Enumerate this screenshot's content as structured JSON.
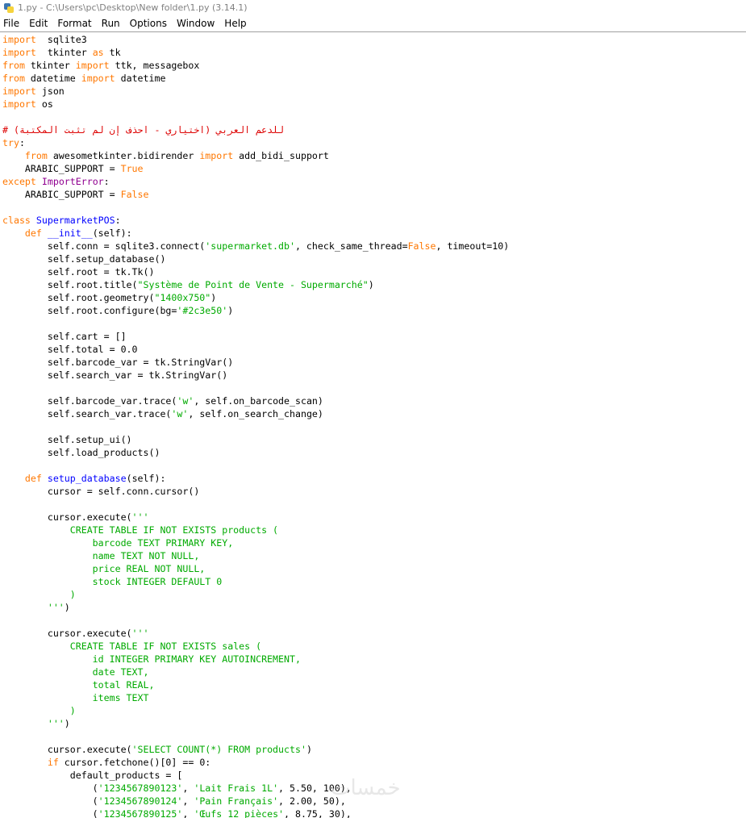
{
  "window": {
    "title": "1.py - C:\\Users\\pc\\Desktop\\New folder\\1.py (3.14.1)"
  },
  "menu": [
    "File",
    "Edit",
    "Format",
    "Run",
    "Options",
    "Window",
    "Help"
  ],
  "watermark": "خمسات",
  "code_lines": [
    [
      [
        "kw",
        "import"
      ],
      [
        "",
        "  sqlite3"
      ]
    ],
    [
      [
        "kw",
        "import"
      ],
      [
        "",
        "  tkinter "
      ],
      [
        "kw",
        "as"
      ],
      [
        "",
        " tk"
      ]
    ],
    [
      [
        "kw",
        "from"
      ],
      [
        "",
        " tkinter "
      ],
      [
        "kw",
        "import"
      ],
      [
        "",
        " ttk, messagebox"
      ]
    ],
    [
      [
        "kw",
        "from"
      ],
      [
        "",
        " datetime "
      ],
      [
        "kw",
        "import"
      ],
      [
        "",
        " datetime"
      ]
    ],
    [
      [
        "kw",
        "import"
      ],
      [
        "",
        " json"
      ]
    ],
    [
      [
        "kw",
        "import"
      ],
      [
        "",
        " os"
      ]
    ],
    [
      [
        "",
        ""
      ]
    ],
    [
      [
        "cm",
        "# للدعم العربي (اختياري - احذف إن لم تثبت المكتبة)"
      ]
    ],
    [
      [
        "kw",
        "try"
      ],
      [
        "",
        ":"
      ]
    ],
    [
      [
        "",
        "    "
      ],
      [
        "kw",
        "from"
      ],
      [
        "",
        " awesometkinter.bidirender "
      ],
      [
        "kw",
        "import"
      ],
      [
        "",
        " add_bidi_support"
      ]
    ],
    [
      [
        "",
        "    ARABIC_SUPPORT = "
      ],
      [
        "kw",
        "True"
      ]
    ],
    [
      [
        "kw",
        "except"
      ],
      [
        "",
        " "
      ],
      [
        "bi",
        "ImportError"
      ],
      [
        "",
        ":"
      ]
    ],
    [
      [
        "",
        "    ARABIC_SUPPORT = "
      ],
      [
        "kw",
        "False"
      ]
    ],
    [
      [
        "",
        ""
      ]
    ],
    [
      [
        "kw",
        "class"
      ],
      [
        "",
        " "
      ],
      [
        "df",
        "SupermarketPOS"
      ],
      [
        "",
        ":"
      ]
    ],
    [
      [
        "",
        "    "
      ],
      [
        "kw",
        "def"
      ],
      [
        "",
        " "
      ],
      [
        "df",
        "__init__"
      ],
      [
        "",
        "(self):"
      ]
    ],
    [
      [
        "",
        "        self.conn = sqlite3.connect("
      ],
      [
        "st",
        "'supermarket.db'"
      ],
      [
        "",
        ", check_same_thread="
      ],
      [
        "kw",
        "False"
      ],
      [
        "",
        ", timeout=10)"
      ]
    ],
    [
      [
        "",
        "        self.setup_database()"
      ]
    ],
    [
      [
        "",
        "        self.root = tk.Tk()"
      ]
    ],
    [
      [
        "",
        "        self.root.title("
      ],
      [
        "st",
        "\"Système de Point de Vente - Supermarché\""
      ],
      [
        "",
        ")"
      ]
    ],
    [
      [
        "",
        "        self.root.geometry("
      ],
      [
        "st",
        "\"1400x750\""
      ],
      [
        "",
        ")"
      ]
    ],
    [
      [
        "",
        "        self.root.configure(bg="
      ],
      [
        "st",
        "'#2c3e50'"
      ],
      [
        "",
        ")"
      ]
    ],
    [
      [
        "",
        ""
      ]
    ],
    [
      [
        "",
        "        self.cart = []"
      ]
    ],
    [
      [
        "",
        "        self.total = 0.0"
      ]
    ],
    [
      [
        "",
        "        self.barcode_var = tk.StringVar()"
      ]
    ],
    [
      [
        "",
        "        self.search_var = tk.StringVar()"
      ]
    ],
    [
      [
        "",
        ""
      ]
    ],
    [
      [
        "",
        "        self.barcode_var.trace("
      ],
      [
        "st",
        "'w'"
      ],
      [
        "",
        ", self.on_barcode_scan)"
      ]
    ],
    [
      [
        "",
        "        self.search_var.trace("
      ],
      [
        "st",
        "'w'"
      ],
      [
        "",
        ", self.on_search_change)"
      ]
    ],
    [
      [
        "",
        ""
      ]
    ],
    [
      [
        "",
        "        self.setup_ui()"
      ]
    ],
    [
      [
        "",
        "        self.load_products()"
      ]
    ],
    [
      [
        "",
        ""
      ]
    ],
    [
      [
        "",
        "    "
      ],
      [
        "kw",
        "def"
      ],
      [
        "",
        " "
      ],
      [
        "df",
        "setup_database"
      ],
      [
        "",
        "(self):"
      ]
    ],
    [
      [
        "",
        "        cursor = self.conn.cursor()"
      ]
    ],
    [
      [
        "",
        ""
      ]
    ],
    [
      [
        "",
        "        cursor.execute("
      ],
      [
        "st",
        "'''"
      ]
    ],
    [
      [
        "st",
        "            CREATE TABLE IF NOT EXISTS products ("
      ]
    ],
    [
      [
        "st",
        "                barcode TEXT PRIMARY KEY,"
      ]
    ],
    [
      [
        "st",
        "                name TEXT NOT NULL,"
      ]
    ],
    [
      [
        "st",
        "                price REAL NOT NULL,"
      ]
    ],
    [
      [
        "st",
        "                stock INTEGER DEFAULT 0"
      ]
    ],
    [
      [
        "st",
        "            )"
      ]
    ],
    [
      [
        "st",
        "        '''"
      ],
      [
        "",
        ")"
      ]
    ],
    [
      [
        "",
        ""
      ]
    ],
    [
      [
        "",
        "        cursor.execute("
      ],
      [
        "st",
        "'''"
      ]
    ],
    [
      [
        "st",
        "            CREATE TABLE IF NOT EXISTS sales ("
      ]
    ],
    [
      [
        "st",
        "                id INTEGER PRIMARY KEY AUTOINCREMENT,"
      ]
    ],
    [
      [
        "st",
        "                date TEXT,"
      ]
    ],
    [
      [
        "st",
        "                total REAL,"
      ]
    ],
    [
      [
        "st",
        "                items TEXT"
      ]
    ],
    [
      [
        "st",
        "            )"
      ]
    ],
    [
      [
        "st",
        "        '''"
      ],
      [
        "",
        ")"
      ]
    ],
    [
      [
        "",
        ""
      ]
    ],
    [
      [
        "",
        "        cursor.execute("
      ],
      [
        "st",
        "'SELECT COUNT(*) FROM products'"
      ],
      [
        "",
        ")"
      ]
    ],
    [
      [
        "",
        "        "
      ],
      [
        "kw",
        "if"
      ],
      [
        "",
        " cursor.fetchone()[0] == 0:"
      ]
    ],
    [
      [
        "",
        "            default_products = ["
      ]
    ],
    [
      [
        "",
        "                ("
      ],
      [
        "st",
        "'1234567890123'"
      ],
      [
        "",
        ", "
      ],
      [
        "st",
        "'Lait Frais 1L'"
      ],
      [
        "",
        ", 5.50, 100),"
      ]
    ],
    [
      [
        "",
        "                ("
      ],
      [
        "st",
        "'1234567890124'"
      ],
      [
        "",
        ", "
      ],
      [
        "st",
        "'Pain Français'"
      ],
      [
        "",
        ", 2.00, 50),"
      ]
    ],
    [
      [
        "",
        "                ("
      ],
      [
        "st",
        "'1234567890125'"
      ],
      [
        "",
        ", "
      ],
      [
        "st",
        "'Œufs 12 pièces'"
      ],
      [
        "",
        ", 8.75, 30),"
      ]
    ]
  ]
}
